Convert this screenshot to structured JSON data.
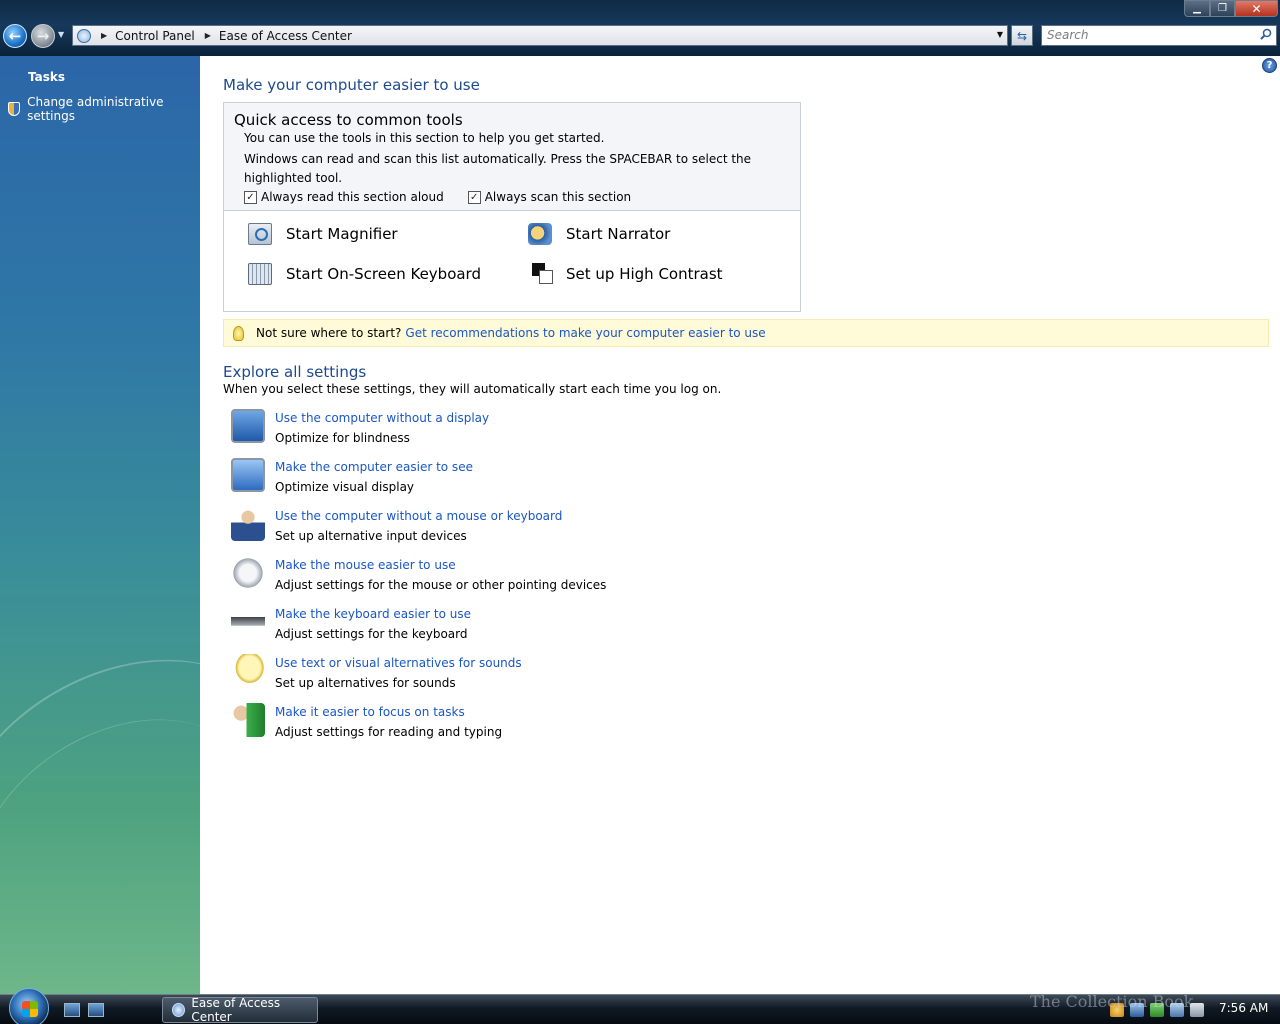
{
  "window": {
    "address": {
      "crumbs": [
        "Control Panel",
        "Ease of Access Center"
      ]
    },
    "search_placeholder": "Search",
    "controls": {
      "minimize": "▁",
      "maximize": "❐",
      "close": "✕"
    }
  },
  "sidebar": {
    "heading": "Tasks",
    "items": [
      {
        "label": "Change administrative settings",
        "icon": "uac-shield-icon"
      }
    ]
  },
  "main": {
    "title": "Make your computer easier to use",
    "quick_access": {
      "heading": "Quick access to common tools",
      "line1": "You can use the tools in this section to help you get started.",
      "line2": "Windows can read and scan this list automatically.  Press the SPACEBAR to select the highlighted tool.",
      "checkboxes": [
        {
          "label": "Always read this section aloud",
          "checked": true
        },
        {
          "label": "Always scan this section",
          "checked": true
        }
      ],
      "tools": [
        {
          "label": "Start Magnifier",
          "icon": "magnifier-icon"
        },
        {
          "label": "Start Narrator",
          "icon": "narrator-icon"
        },
        {
          "label": "Start On-Screen Keyboard",
          "icon": "on-screen-keyboard-icon"
        },
        {
          "label": "Set up High Contrast",
          "icon": "high-contrast-icon"
        }
      ]
    },
    "tip": {
      "prefix": "Not sure where to start?",
      "link": "Get recommendations to make your computer easier to use"
    },
    "explore": {
      "title": "Explore all settings",
      "description": "When you select these settings, they will automatically start each time you log on.",
      "settings": [
        {
          "title": "Use the computer without a display",
          "desc": "Optimize for blindness",
          "icon": "monitor-icon"
        },
        {
          "title": "Make the computer easier to see",
          "desc": "Optimize visual display",
          "icon": "monitor-magnify-icon"
        },
        {
          "title": "Use the computer without a mouse or keyboard",
          "desc": "Set up alternative input devices",
          "icon": "person-icon"
        },
        {
          "title": "Make the mouse easier to use",
          "desc": "Adjust settings for the mouse or other pointing devices",
          "icon": "mouse-icon"
        },
        {
          "title": "Make the keyboard easier to use",
          "desc": "Adjust settings for the keyboard",
          "icon": "keyboard-icon"
        },
        {
          "title": "Use text or visual alternatives for sounds",
          "desc": "Set up alternatives for sounds",
          "icon": "speech-bubble-warning-icon"
        },
        {
          "title": "Make it easier to focus on tasks",
          "desc": "Adjust settings for reading and typing",
          "icon": "person-focus-icon"
        }
      ]
    }
  },
  "taskbar": {
    "window_button": "Ease of Access Center",
    "clock": "7:56 AM",
    "watermark": "The Collection Book"
  }
}
